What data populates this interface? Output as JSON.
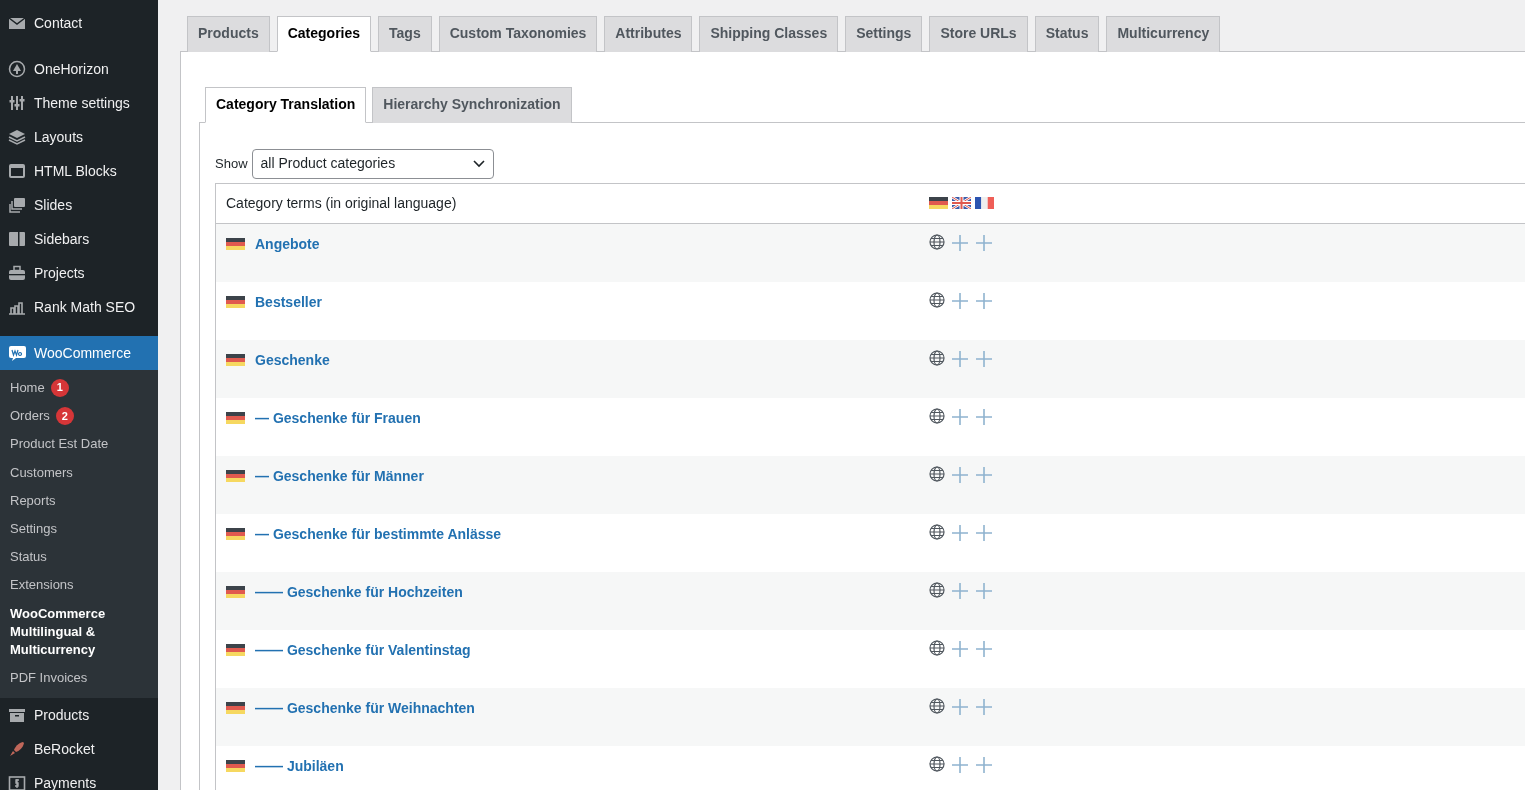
{
  "sidebar": {
    "items_before": [
      {
        "label": "Contact",
        "selected": false
      },
      {
        "label": "OneHorizon",
        "selected": false
      },
      {
        "label": "Theme settings",
        "selected": false
      },
      {
        "label": "Layouts",
        "selected": false
      },
      {
        "label": "HTML Blocks",
        "selected": false
      },
      {
        "label": "Slides",
        "selected": false
      },
      {
        "label": "Sidebars",
        "selected": false
      },
      {
        "label": "Projects",
        "selected": false
      },
      {
        "label": "Rank Math SEO",
        "selected": false
      },
      {
        "label": "WooCommerce",
        "selected": true
      }
    ],
    "submenu": [
      {
        "label": "Home",
        "badge": "1",
        "selected": false
      },
      {
        "label": "Orders",
        "badge": "2",
        "selected": false
      },
      {
        "label": "Product Est Date",
        "selected": false
      },
      {
        "label": "Customers",
        "selected": false
      },
      {
        "label": "Reports",
        "selected": false
      },
      {
        "label": "Settings",
        "selected": false
      },
      {
        "label": "Status",
        "selected": false
      },
      {
        "label": "Extensions",
        "selected": false
      },
      {
        "label": "WooCommerce Multilingual & Multicurrency",
        "selected": true
      },
      {
        "label": "PDF Invoices",
        "selected": false
      }
    ],
    "items_after": [
      {
        "label": "Products",
        "selected": false
      },
      {
        "label": "BeRocket",
        "selected": false
      },
      {
        "label": "Payments",
        "selected": false
      }
    ]
  },
  "tabs": [
    {
      "label": "Products",
      "selected": false
    },
    {
      "label": "Categories",
      "selected": true
    },
    {
      "label": "Tags",
      "selected": false
    },
    {
      "label": "Custom Taxonomies",
      "selected": false
    },
    {
      "label": "Attributes",
      "selected": false
    },
    {
      "label": "Shipping Classes",
      "selected": false
    },
    {
      "label": "Settings",
      "selected": false
    },
    {
      "label": "Store URLs",
      "selected": false
    },
    {
      "label": "Status",
      "selected": false
    },
    {
      "label": "Multicurrency",
      "selected": false
    }
  ],
  "subtabs": [
    {
      "label": "Category Translation",
      "selected": true
    },
    {
      "label": "Hierarchy Synchronization",
      "selected": false
    }
  ],
  "filter": {
    "label": "Show",
    "value": "all Product categories"
  },
  "table": {
    "column_1": "Category terms (in original language)",
    "rows": [
      {
        "name": "Angebote"
      },
      {
        "name": "Bestseller"
      },
      {
        "name": "Geschenke"
      },
      {
        "name": "— Geschenke für Frauen"
      },
      {
        "name": "— Geschenke für Männer"
      },
      {
        "name": "— Geschenke für bestimmte Anlässe"
      },
      {
        "name": "—— Geschenke für Hochzeiten"
      },
      {
        "name": "—— Geschenke für Valentinstag"
      },
      {
        "name": "—— Geschenke für Weihnachten"
      },
      {
        "name": "—— Jubiläen"
      }
    ]
  }
}
